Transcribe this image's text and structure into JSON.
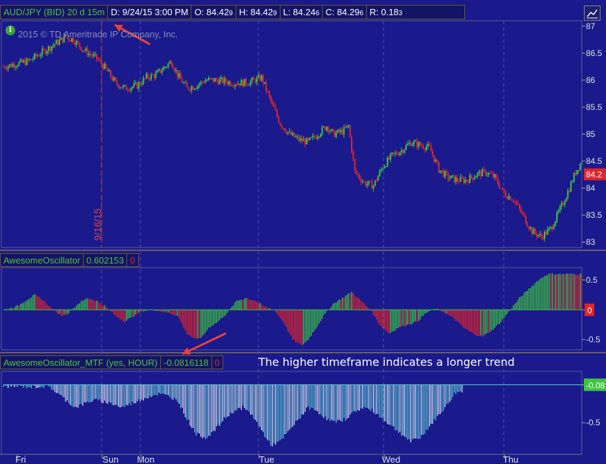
{
  "header": {
    "symbol": "AUD/JPY (BID) 20 d 15m",
    "date": "D: 9/24/15 3:00 PM",
    "open": "O: 84.42",
    "open_frac": "9",
    "high": "H: 84.42",
    "high_frac": "9",
    "low": "L: 84.24",
    "low_frac": "6",
    "close": "C: 84.29",
    "close_frac": "6",
    "range": "R: 0.18",
    "range_frac": "3"
  },
  "copyright": "2015 © TD Ameritrade IP Company, Inc.",
  "info_icon": "i",
  "study1": {
    "name": "AwesomeOscillator",
    "value": "0.602153",
    "extra": "0",
    "badge": "0"
  },
  "study2": {
    "name": "AwesomeOscillator_MTF (yes, HOUR)",
    "value": "-0.0816118",
    "extra": "0",
    "badge": "-0.08"
  },
  "annotation": "The higher timeframe indicates a longer trend",
  "price_badge": "84.2",
  "date_marker": "9/16/15",
  "colors": {
    "bg": "#1a1a8c",
    "up": "#3ec63e",
    "down": "#e0262a",
    "mtf": "#5fd0d8",
    "grid": "#4d4db0",
    "price_badge": "#e0262a",
    "mtf_badge": "#3ec63e"
  },
  "chart_data": {
    "type": "candlestick",
    "symbol": "AUD/JPY",
    "interval": "15m",
    "x_ticks": [
      "Fri",
      "Sun",
      "Mon",
      "Tue",
      "Wed",
      "Thu"
    ],
    "price_ticks": [
      87,
      86.5,
      86,
      85.5,
      85,
      84.5,
      84,
      83.5,
      83
    ],
    "price_ylim": [
      82.9,
      87.1
    ],
    "price_path": [
      [
        0,
        86.25
      ],
      [
        8,
        86.3
      ],
      [
        16,
        86.35
      ],
      [
        24,
        86.5
      ],
      [
        32,
        86.65
      ],
      [
        40,
        86.8
      ],
      [
        45,
        86.75
      ],
      [
        52,
        86.55
      ],
      [
        60,
        86.4
      ],
      [
        66,
        86.2
      ],
      [
        72,
        85.95
      ],
      [
        78,
        85.85
      ],
      [
        86,
        85.9
      ],
      [
        92,
        86.05
      ],
      [
        98,
        86.1
      ],
      [
        104,
        86.25
      ],
      [
        108,
        86.35
      ],
      [
        112,
        86.1
      ],
      [
        118,
        85.85
      ],
      [
        124,
        85.9
      ],
      [
        130,
        86.0
      ],
      [
        136,
        86.0
      ],
      [
        142,
        85.98
      ],
      [
        148,
        85.95
      ],
      [
        154,
        85.95
      ],
      [
        160,
        85.98
      ],
      [
        166,
        86.05
      ],
      [
        172,
        85.6
      ],
      [
        178,
        85.2
      ],
      [
        184,
        85.0
      ],
      [
        190,
        84.9
      ],
      [
        196,
        84.85
      ],
      [
        202,
        85.0
      ],
      [
        208,
        85.15
      ],
      [
        212,
        85.0
      ],
      [
        218,
        85.05
      ],
      [
        222,
        85.15
      ],
      [
        226,
        84.3
      ],
      [
        232,
        84.1
      ],
      [
        238,
        84.05
      ],
      [
        244,
        84.4
      ],
      [
        250,
        84.6
      ],
      [
        256,
        84.7
      ],
      [
        262,
        84.85
      ],
      [
        268,
        84.8
      ],
      [
        274,
        84.75
      ],
      [
        280,
        84.35
      ],
      [
        286,
        84.2
      ],
      [
        292,
        84.15
      ],
      [
        298,
        84.15
      ],
      [
        304,
        84.25
      ],
      [
        310,
        84.3
      ],
      [
        316,
        84.2
      ],
      [
        322,
        83.9
      ],
      [
        328,
        83.8
      ],
      [
        334,
        83.5
      ],
      [
        340,
        83.2
      ],
      [
        346,
        83.1
      ],
      [
        352,
        83.25
      ],
      [
        358,
        83.6
      ],
      [
        364,
        84.0
      ],
      [
        368,
        84.3
      ],
      [
        372,
        84.5
      ]
    ],
    "ao_ticks": [
      0.5,
      0,
      -0.5
    ],
    "ao_ylim": [
      -0.65,
      0.65
    ],
    "ao_last": 0.602153,
    "ao_path": [
      [
        0,
        0.0
      ],
      [
        8,
        0.05
      ],
      [
        14,
        0.15
      ],
      [
        20,
        0.25
      ],
      [
        26,
        0.15
      ],
      [
        30,
        0.05
      ],
      [
        34,
        -0.05
      ],
      [
        38,
        -0.1
      ],
      [
        42,
        -0.05
      ],
      [
        48,
        0.1
      ],
      [
        54,
        0.2
      ],
      [
        60,
        0.15
      ],
      [
        66,
        0.05
      ],
      [
        72,
        -0.1
      ],
      [
        78,
        -0.2
      ],
      [
        84,
        -0.1
      ],
      [
        90,
        -0.02
      ],
      [
        96,
        0.0
      ],
      [
        100,
        -0.02
      ],
      [
        106,
        -0.05
      ],
      [
        112,
        -0.1
      ],
      [
        118,
        -0.4
      ],
      [
        124,
        -0.5
      ],
      [
        128,
        -0.45
      ],
      [
        132,
        -0.3
      ],
      [
        138,
        -0.2
      ],
      [
        144,
        -0.05
      ],
      [
        150,
        0.15
      ],
      [
        156,
        0.2
      ],
      [
        162,
        0.15
      ],
      [
        168,
        0.05
      ],
      [
        174,
        0.0
      ],
      [
        180,
        -0.2
      ],
      [
        186,
        -0.5
      ],
      [
        192,
        -0.6
      ],
      [
        196,
        -0.5
      ],
      [
        200,
        -0.35
      ],
      [
        206,
        -0.1
      ],
      [
        212,
        0.1
      ],
      [
        218,
        0.2
      ],
      [
        224,
        0.3
      ],
      [
        230,
        0.15
      ],
      [
        236,
        0.0
      ],
      [
        242,
        -0.25
      ],
      [
        248,
        -0.4
      ],
      [
        254,
        -0.3
      ],
      [
        260,
        -0.25
      ],
      [
        266,
        -0.2
      ],
      [
        272,
        -0.05
      ],
      [
        278,
        0.02
      ],
      [
        284,
        -0.05
      ],
      [
        290,
        -0.15
      ],
      [
        296,
        -0.3
      ],
      [
        302,
        -0.4
      ],
      [
        308,
        -0.45
      ],
      [
        314,
        -0.35
      ],
      [
        320,
        -0.2
      ],
      [
        326,
        0.0
      ],
      [
        332,
        0.2
      ],
      [
        338,
        0.35
      ],
      [
        344,
        0.5
      ],
      [
        350,
        0.6
      ]
    ],
    "mtf_ticks": [
      0,
      -0.5
    ],
    "mtf_ylim": [
      -0.9,
      0.15
    ],
    "mtf_last": -0.0816118,
    "mtf_path": [
      [
        0,
        -0.02
      ],
      [
        10,
        -0.02
      ],
      [
        18,
        -0.03
      ],
      [
        24,
        -0.02
      ],
      [
        30,
        -0.03
      ],
      [
        34,
        -0.1
      ],
      [
        40,
        -0.2
      ],
      [
        46,
        -0.3
      ],
      [
        52,
        -0.25
      ],
      [
        58,
        -0.2
      ],
      [
        64,
        -0.22
      ],
      [
        70,
        -0.25
      ],
      [
        76,
        -0.3
      ],
      [
        82,
        -0.25
      ],
      [
        88,
        -0.2
      ],
      [
        94,
        -0.15
      ],
      [
        100,
        -0.12
      ],
      [
        106,
        -0.15
      ],
      [
        112,
        -0.2
      ],
      [
        118,
        -0.45
      ],
      [
        124,
        -0.65
      ],
      [
        130,
        -0.7
      ],
      [
        136,
        -0.6
      ],
      [
        142,
        -0.45
      ],
      [
        148,
        -0.35
      ],
      [
        154,
        -0.3
      ],
      [
        160,
        -0.4
      ],
      [
        166,
        -0.6
      ],
      [
        172,
        -0.8
      ],
      [
        178,
        -0.75
      ],
      [
        184,
        -0.6
      ],
      [
        190,
        -0.45
      ],
      [
        196,
        -0.3
      ],
      [
        202,
        -0.35
      ],
      [
        208,
        -0.45
      ],
      [
        214,
        -0.5
      ],
      [
        220,
        -0.45
      ],
      [
        226,
        -0.35
      ],
      [
        232,
        -0.3
      ],
      [
        238,
        -0.35
      ],
      [
        244,
        -0.45
      ],
      [
        250,
        -0.55
      ],
      [
        256,
        -0.65
      ],
      [
        262,
        -0.75
      ],
      [
        268,
        -0.7
      ],
      [
        274,
        -0.55
      ],
      [
        280,
        -0.4
      ],
      [
        286,
        -0.25
      ],
      [
        290,
        -0.12
      ],
      [
        295,
        -0.08
      ]
    ]
  }
}
